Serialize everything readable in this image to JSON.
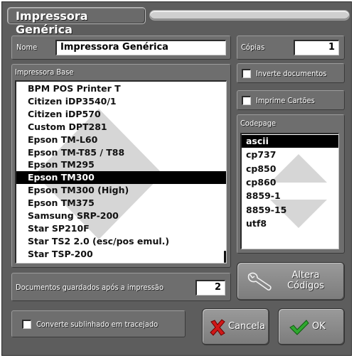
{
  "window": {
    "title": "Impressora Genérica"
  },
  "name_field": {
    "label": "Nome",
    "value": "Impressora Genérica"
  },
  "copies_field": {
    "label": "Cópias",
    "value": "1"
  },
  "base_printer": {
    "label": "Impressora Base",
    "items": [
      "BPM POS Printer T",
      "Citizen iDP3540/1",
      "Citizen iDP570",
      "Custom DPT281",
      "Epson TM-L60",
      "Epson TM-T85 / T88",
      "Epson TM295",
      "Epson TM300",
      "Epson TM300 (High)",
      "Epson TM375",
      "Samsung SRP-200",
      "Star SP210F",
      "Star TS2 2.0 (esc/pos emul.)",
      "Star TSP-200"
    ],
    "selected": "Epson TM300"
  },
  "options": {
    "invert_docs": "Inverte documentos",
    "print_cards": "Imprime Cartões"
  },
  "codepage": {
    "label": "Codepage",
    "items": [
      "ascii",
      "cp737",
      "cp850",
      "cp860",
      "8859-1",
      "8859-15",
      "utf8"
    ],
    "selected": "ascii"
  },
  "saved_docs": {
    "label": "Documentos guardados após a impressão",
    "value": "2"
  },
  "convert_underline": {
    "label": "Converte sublinhado em tracejado"
  },
  "buttons": {
    "altera_codigos_line1": "Altera",
    "altera_codigos_line2": "Códigos",
    "cancel": "Cancela",
    "ok": "OK"
  },
  "icons": {
    "wrench": "wrench-icon",
    "cancel": "red-x-icon",
    "ok": "green-check-icon"
  },
  "colors": {
    "panel": "#6e6e6e",
    "window": "#5d5d5d",
    "selection": "#000000",
    "cancel_icon": "#d01818",
    "ok_icon": "#2fa82f"
  }
}
